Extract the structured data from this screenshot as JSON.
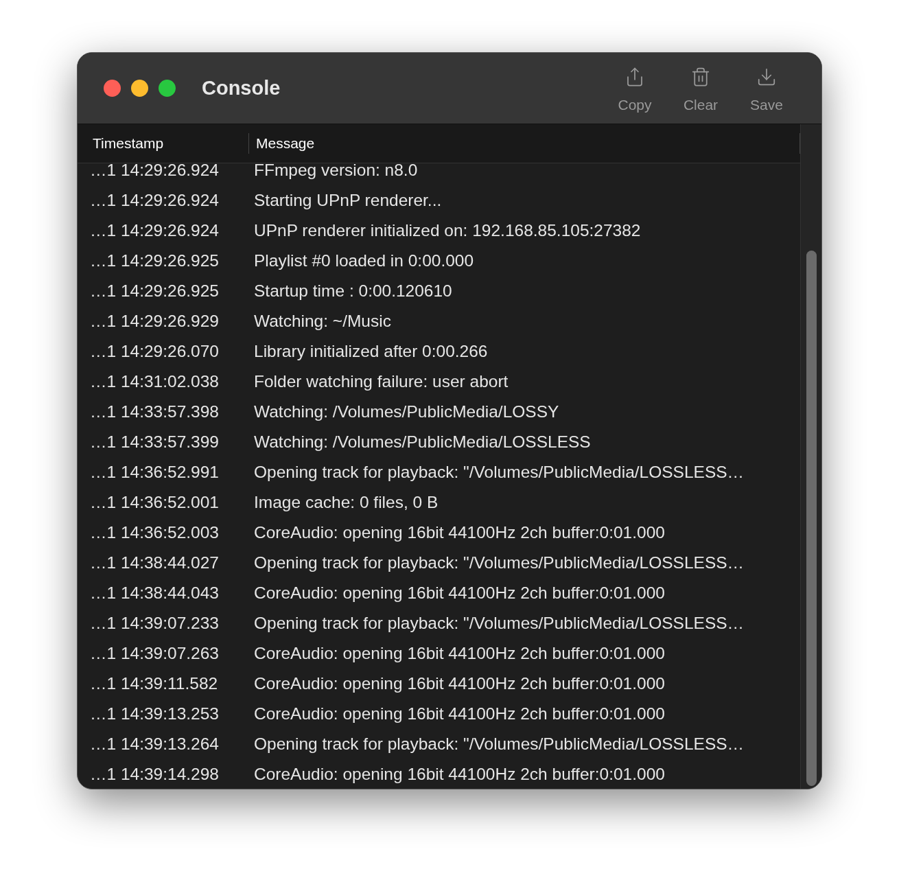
{
  "window": {
    "title": "Console"
  },
  "toolbar": [
    {
      "kind": "copy",
      "label": "Copy"
    },
    {
      "kind": "clear",
      "label": "Clear"
    },
    {
      "kind": "save",
      "label": "Save"
    }
  ],
  "table": {
    "columns": [
      "Timestamp",
      "Message"
    ],
    "rows": [
      {
        "timestamp": "…1 14:29:26.924",
        "message": "FFmpeg version: n8.0"
      },
      {
        "timestamp": "…1 14:29:26.924",
        "message": "Starting UPnP renderer..."
      },
      {
        "timestamp": "…1 14:29:26.924",
        "message": "UPnP renderer initialized on: 192.168.85.105:27382"
      },
      {
        "timestamp": "…1 14:29:26.925",
        "message": "Playlist #0 loaded in 0:00.000"
      },
      {
        "timestamp": "…1 14:29:26.925",
        "message": "Startup time : 0:00.120610"
      },
      {
        "timestamp": "…1 14:29:26.929",
        "message": "Watching: ~/Music"
      },
      {
        "timestamp": "…1 14:29:26.070",
        "message": "Library initialized after 0:00.266"
      },
      {
        "timestamp": "…1 14:31:02.038",
        "message": "Folder watching failure: user abort"
      },
      {
        "timestamp": "…1 14:33:57.398",
        "message": "Watching: /Volumes/PublicMedia/LOSSY"
      },
      {
        "timestamp": "…1 14:33:57.399",
        "message": "Watching: /Volumes/PublicMedia/LOSSLESS"
      },
      {
        "timestamp": "…1 14:36:52.991",
        "message": "Opening track for playback: \"/Volumes/PublicMedia/LOSSLESS…"
      },
      {
        "timestamp": "…1 14:36:52.001",
        "message": "Image cache: 0 files, 0 B"
      },
      {
        "timestamp": "…1 14:36:52.003",
        "message": "CoreAudio: opening 16bit 44100Hz 2ch buffer:0:01.000"
      },
      {
        "timestamp": "…1 14:38:44.027",
        "message": "Opening track for playback: \"/Volumes/PublicMedia/LOSSLESS…"
      },
      {
        "timestamp": "…1 14:38:44.043",
        "message": "CoreAudio: opening 16bit 44100Hz 2ch buffer:0:01.000"
      },
      {
        "timestamp": "…1 14:39:07.233",
        "message": "Opening track for playback: \"/Volumes/PublicMedia/LOSSLESS…"
      },
      {
        "timestamp": "…1 14:39:07.263",
        "message": "CoreAudio: opening 16bit 44100Hz 2ch buffer:0:01.000"
      },
      {
        "timestamp": "…1 14:39:11.582",
        "message": "CoreAudio: opening 16bit 44100Hz 2ch buffer:0:01.000"
      },
      {
        "timestamp": "…1 14:39:13.253",
        "message": "CoreAudio: opening 16bit 44100Hz 2ch buffer:0:01.000"
      },
      {
        "timestamp": "…1 14:39:13.264",
        "message": "Opening track for playback: \"/Volumes/PublicMedia/LOSSLESS…"
      },
      {
        "timestamp": "…1 14:39:14.298",
        "message": "CoreAudio: opening 16bit 44100Hz 2ch buffer:0:01.000"
      }
    ]
  }
}
